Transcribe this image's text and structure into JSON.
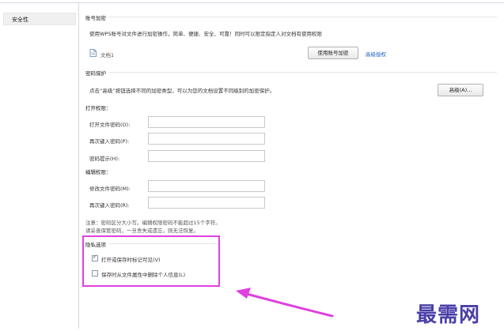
{
  "sidebar": {
    "selected_item": "安全性"
  },
  "account_encrypt": {
    "title": "账号加密",
    "description": "使用WPS账号对文件进行加密操作，简单、便捷、安全、可靠！同时可以限定指定人对文档有使用权限",
    "doc_name": "文档1",
    "encrypt_button": "使用账号加密",
    "advanced_link": "高级授权"
  },
  "password_protect": {
    "title": "密码保护",
    "description": "点击“高级”按钮选择不同的加密类型，可以为您的文档设置不同级别的加密保护。",
    "advanced_button": "高级(A)...",
    "open_perm": {
      "title": "打开权限：",
      "password_label": "打开文件密码(O):",
      "confirm_label": "再次键入密码(P):",
      "hint_label": "密码提示(H):"
    },
    "edit_perm": {
      "title": "编辑权限：",
      "password_label": "修改文件密码(M):",
      "confirm_label": "再次键入密码(R):"
    },
    "note_line1": "注意：密码区分大小写。编辑权限密码不能超过15个字符。",
    "note_line2": "请妥善保管密码，一旦丢失或遗忘，则无法恢复。"
  },
  "privacy": {
    "title": "隐私选项",
    "option1": {
      "label": "打开或保存时标记可见(V)",
      "checked": true
    },
    "option2": {
      "label": "保存时从文件属性中删除个人信息(L)",
      "checked": false
    }
  },
  "colors": {
    "highlight": "#e040e0",
    "link": "#1f5fbf",
    "watermark": "#4a3fa8"
  },
  "watermark": "最需网"
}
